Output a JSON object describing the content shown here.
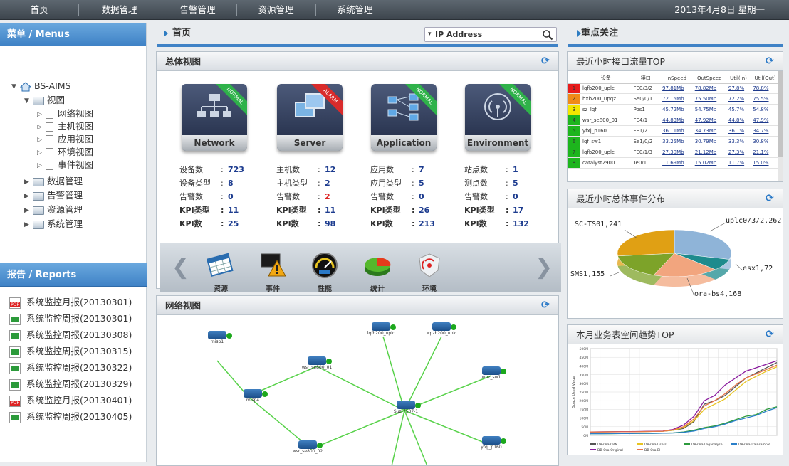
{
  "nav": {
    "items": [
      "首页",
      "数据管理",
      "告警管理",
      "资源管理",
      "系统管理"
    ],
    "date": "2013年4月8日 星期一"
  },
  "left": {
    "menu_title": "菜单 / Menus",
    "tree": {
      "root": "BS-AIMS",
      "view": "视图",
      "view_children": [
        "网络视图",
        "主机视图",
        "应用视图",
        "环境视图",
        "事件视图"
      ],
      "others": [
        "数据管理",
        "告警管理",
        "资源管理",
        "系统管理"
      ]
    },
    "reports_title": "报告 / Reports",
    "reports": [
      {
        "name": "系统监控月报(20130301)",
        "type": "pdf"
      },
      {
        "name": "系统监控周报(20130301)",
        "type": "xls"
      },
      {
        "name": "系统监控周报(20130308)",
        "type": "xls"
      },
      {
        "name": "系统监控周报(20130315)",
        "type": "xls"
      },
      {
        "name": "系统监控周报(20130322)",
        "type": "xls"
      },
      {
        "name": "系统监控周报(20130329)",
        "type": "xls"
      },
      {
        "name": "系统监控月报(20130401)",
        "type": "pdf"
      },
      {
        "name": "系统监控周报(20130405)",
        "type": "xls"
      }
    ]
  },
  "main": {
    "title": "首页",
    "search_placeholder": "IP Address",
    "overview": {
      "title": "总体视图",
      "categories": [
        {
          "name": "Network",
          "badge": "NORMAL",
          "badge_color": "#2fb24a",
          "stats": [
            [
              "设备数",
              "723"
            ],
            [
              "设备类型",
              "8"
            ],
            [
              "告警数",
              "0"
            ],
            [
              "KPI类型",
              "11"
            ],
            [
              "KPI数",
              "25"
            ]
          ]
        },
        {
          "name": "Server",
          "badge": "ALARM",
          "badge_color": "#d92b2b",
          "stats": [
            [
              "主机数",
              "12"
            ],
            [
              "主机类型",
              "2"
            ],
            [
              "告警数",
              "2"
            ],
            [
              "KPI类型",
              "11"
            ],
            [
              "KPI数",
              "98"
            ]
          ]
        },
        {
          "name": "Application",
          "badge": "NORMAL",
          "badge_color": "#2fb24a",
          "stats": [
            [
              "应用数",
              "7"
            ],
            [
              "应用类型",
              "5"
            ],
            [
              "告警数",
              "0"
            ],
            [
              "KPI类型",
              "26"
            ],
            [
              "KPI数",
              "213"
            ]
          ]
        },
        {
          "name": "Environment",
          "badge": "NORMAL",
          "badge_color": "#2fb24a",
          "stats": [
            [
              "站点数",
              "1"
            ],
            [
              "测点数",
              "5"
            ],
            [
              "告警数",
              "0"
            ],
            [
              "KPI类型",
              "17"
            ],
            [
              "KPI数",
              "132"
            ]
          ]
        }
      ],
      "toolbar": [
        "资源",
        "事件",
        "性能",
        "统计",
        "环境"
      ]
    },
    "network": {
      "title": "网络视图",
      "nodes": [
        "misp1",
        "wsr_se800_01",
        "lqfb200_uplc",
        "wpzb200_uplc",
        "misp4",
        "wpz_sw1",
        "Suz-7507-1",
        "wsr_se800_02",
        "yfqj_p160"
      ]
    }
  },
  "right": {
    "title": "重点关注",
    "traffic": {
      "title": "最近小时接口流量TOP",
      "headers": [
        "",
        "设备",
        "接口",
        "InSpeed",
        "OutSpeed",
        "Util(In)",
        "Util(Out)"
      ],
      "rows": [
        [
          "1",
          "lqfb200_uplc",
          "FE0/3/2",
          "97.81Mb",
          "78.82Mb",
          "97.8%",
          "78.8%"
        ],
        [
          "2",
          "hxb200_upqz",
          "Se0/0/1",
          "72.15Mb",
          "75.50Mb",
          "72.2%",
          "75.5%"
        ],
        [
          "3",
          "sz_lqf",
          "Pos1",
          "45.72Mb",
          "54.75Mb",
          "45.7%",
          "54.8%"
        ],
        [
          "4",
          "wsr_se800_01",
          "FE4/1",
          "44.83Mb",
          "47.92Mb",
          "44.8%",
          "47.9%"
        ],
        [
          "5",
          "yfxj_p160",
          "FE1/2",
          "36.11Mb",
          "34.73Mb",
          "36.1%",
          "34.7%"
        ],
        [
          "6",
          "lqf_sw1",
          "Se1/0/2",
          "33.25Mb",
          "30.79Mb",
          "33.3%",
          "30.8%"
        ],
        [
          "7",
          "lqfb200_uplc",
          "FE0/1/3",
          "27.30Mb",
          "21.12Mb",
          "27.3%",
          "21.1%"
        ],
        [
          "8",
          "catalyst2900",
          "Te0/1",
          "11.69Mb",
          "15.02Mb",
          "11.7%",
          "15.0%"
        ]
      ],
      "rank_colors": [
        "#e81b1b",
        "#f08a18",
        "#f2e600",
        "#1db51d",
        "#1db51d",
        "#1db51d",
        "#1db51d",
        "#1db51d"
      ]
    },
    "events": {
      "title": "最近小时总体事件分布"
    },
    "trend": {
      "title": "本月业务表空间趋势TOP"
    }
  },
  "chart_data": [
    {
      "type": "pie",
      "title": "最近小时总体事件分布",
      "labels": [
        "uplc0/3/2",
        "esx1",
        "ora-bs4",
        "SMS1",
        "SC-TS01"
      ],
      "values": [
        262,
        72,
        168,
        155,
        241
      ],
      "colors": [
        "#8fb4d8",
        "#1e8b8d",
        "#f2a57e",
        "#7da329",
        "#e0a014"
      ]
    },
    {
      "type": "line",
      "title": "本月业务表空间趋势TOP",
      "ylabel": "Space Used Value",
      "yticks": [
        "0M",
        "50M",
        "100M",
        "150M",
        "200M",
        "250M",
        "300M",
        "350M",
        "400M",
        "450M",
        "500M"
      ],
      "ylim": [
        0,
        500
      ],
      "series": [
        {
          "name": "DB-Ora-CRM",
          "color": "#555555",
          "values": [
            20,
            20,
            21,
            21,
            22,
            22,
            23,
            24,
            30,
            40,
            80,
            180,
            200,
            230,
            280,
            330,
            360,
            390,
            420
          ]
        },
        {
          "name": "DB-Ora-Users",
          "color": "#e8c420",
          "values": [
            20,
            20,
            21,
            21,
            22,
            22,
            23,
            24,
            30,
            45,
            85,
            150,
            180,
            210,
            260,
            310,
            340,
            370,
            395
          ]
        },
        {
          "name": "DB-Ora-Loganalyse",
          "color": "#2d9a3d",
          "values": [
            10,
            10,
            10,
            11,
            11,
            12,
            12,
            13,
            15,
            20,
            30,
            45,
            55,
            70,
            90,
            110,
            120,
            150,
            165
          ]
        },
        {
          "name": "DB-Ora-Trainsample",
          "color": "#2a7fc9",
          "values": [
            10,
            10,
            11,
            11,
            11,
            12,
            12,
            13,
            14,
            18,
            25,
            40,
            50,
            65,
            85,
            100,
            115,
            140,
            160
          ]
        },
        {
          "name": "DB-Ora-Original",
          "color": "#8a1a9e",
          "values": [
            20,
            21,
            21,
            22,
            22,
            23,
            24,
            25,
            35,
            60,
            110,
            200,
            230,
            290,
            330,
            370,
            390,
            410,
            430
          ]
        },
        {
          "name": "DB-Ora-BI",
          "color": "#e8744a",
          "values": [
            20,
            20,
            20,
            21,
            21,
            22,
            23,
            24,
            32,
            50,
            95,
            170,
            200,
            240,
            290,
            330,
            355,
            380,
            405
          ]
        }
      ]
    }
  ]
}
